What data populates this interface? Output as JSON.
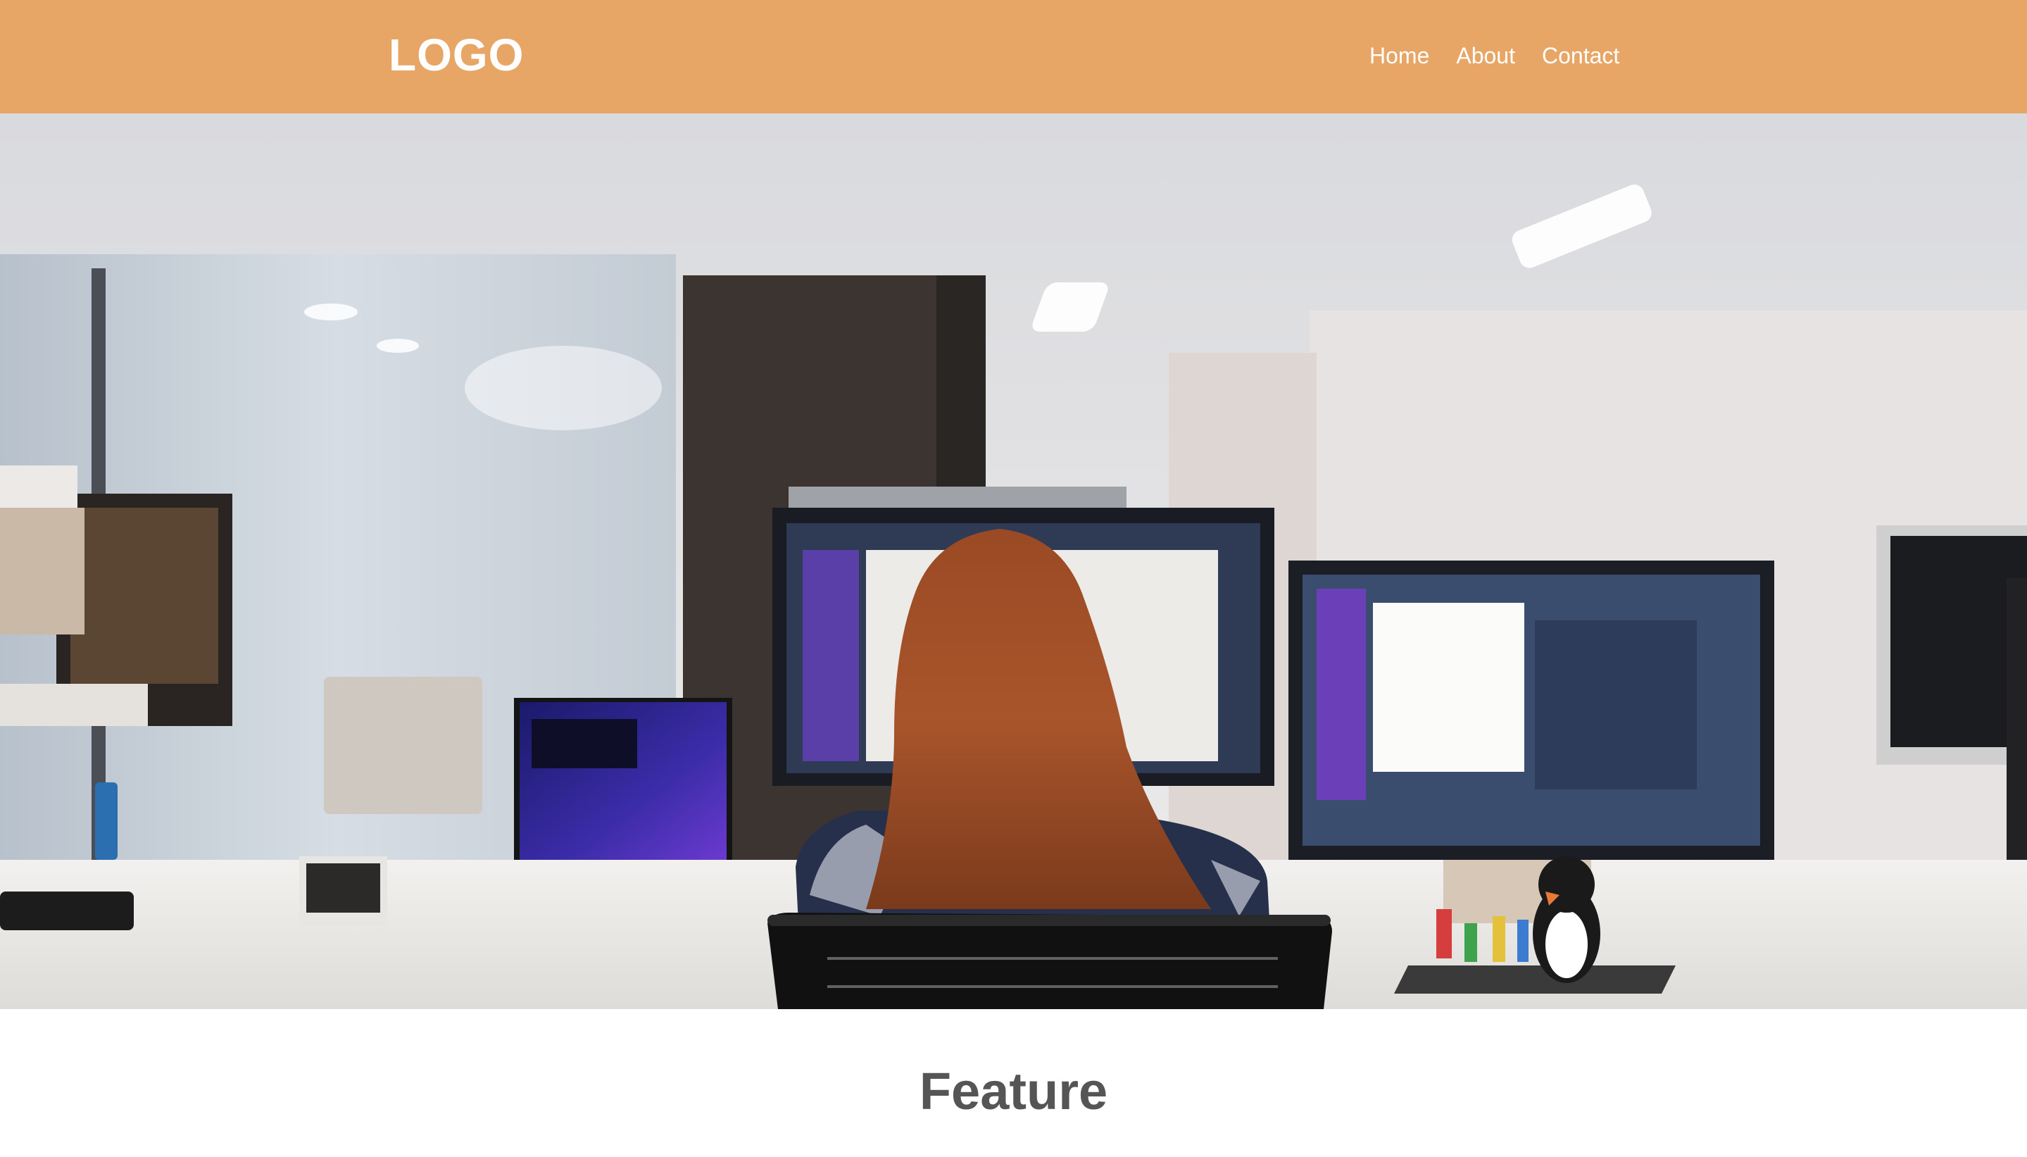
{
  "header": {
    "logo": "LOGO",
    "nav": [
      {
        "label": "Home"
      },
      {
        "label": "About"
      },
      {
        "label": "Contact"
      }
    ]
  },
  "hero": {
    "image": "office-photo-woman-at-computers"
  },
  "section": {
    "title": "Feature"
  },
  "colors": {
    "header_bg": "#e8a666",
    "header_text": "#ffffff",
    "title_text": "#555555"
  }
}
